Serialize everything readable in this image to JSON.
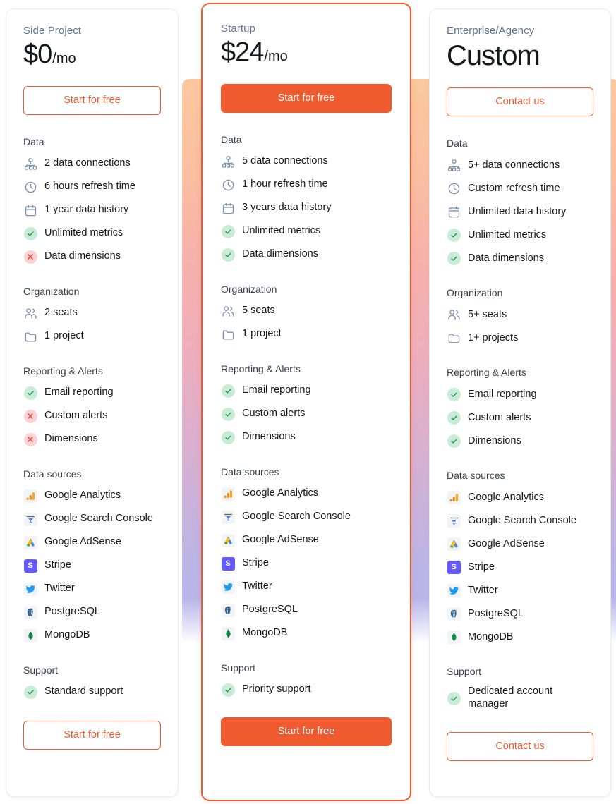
{
  "theme": {
    "accent": "#ef5a2e",
    "plan_name_color": "#64748b",
    "yes_color": "#1f9254",
    "no_color": "#e8403a",
    "gradient_from": "#fbc89d",
    "gradient_to": "#b3b6ee"
  },
  "plans": [
    {
      "id": "side-project",
      "name": "Side Project",
      "price": "$0",
      "period": "/mo",
      "cta_top": "Start for free",
      "cta_bottom": "Start for free",
      "featured": false,
      "sections": [
        {
          "title": "Data",
          "items": [
            {
              "icon": "network-icon",
              "label": "2 data connections"
            },
            {
              "icon": "clock-icon",
              "label": "6 hours refresh time"
            },
            {
              "icon": "calendar-icon",
              "label": "1 year data history"
            },
            {
              "icon": "check-circle-icon",
              "label": "Unlimited metrics"
            },
            {
              "icon": "x-circle-icon",
              "label": "Data dimensions"
            }
          ]
        },
        {
          "title": "Organization",
          "items": [
            {
              "icon": "users-icon",
              "label": "2 seats"
            },
            {
              "icon": "folder-icon",
              "label": "1 project"
            }
          ]
        },
        {
          "title": "Reporting & Alerts",
          "items": [
            {
              "icon": "check-circle-icon",
              "label": "Email reporting"
            },
            {
              "icon": "x-circle-icon",
              "label": "Custom alerts"
            },
            {
              "icon": "x-circle-icon",
              "label": "Dimensions"
            }
          ]
        },
        {
          "title": "Data sources",
          "items": [
            {
              "icon": "google-analytics-icon",
              "label": "Google Analytics"
            },
            {
              "icon": "google-search-console-icon",
              "label": "Google Search Console"
            },
            {
              "icon": "google-adsense-icon",
              "label": "Google AdSense"
            },
            {
              "icon": "stripe-icon",
              "label": "Stripe"
            },
            {
              "icon": "twitter-icon",
              "label": "Twitter"
            },
            {
              "icon": "postgresql-icon",
              "label": "PostgreSQL"
            },
            {
              "icon": "mongodb-icon",
              "label": "MongoDB"
            }
          ]
        },
        {
          "title": "Support",
          "items": [
            {
              "icon": "check-circle-icon",
              "label": "Standard support"
            }
          ]
        }
      ]
    },
    {
      "id": "startup",
      "name": "Startup",
      "price": "$24",
      "period": "/mo",
      "cta_top": "Start for free",
      "cta_bottom": "Start for free",
      "featured": true,
      "sections": [
        {
          "title": "Data",
          "items": [
            {
              "icon": "network-icon",
              "label": "5 data connections"
            },
            {
              "icon": "clock-icon",
              "label": "1 hour refresh time"
            },
            {
              "icon": "calendar-icon",
              "label": "3 years data history"
            },
            {
              "icon": "check-circle-icon",
              "label": "Unlimited metrics"
            },
            {
              "icon": "check-circle-icon",
              "label": "Data dimensions"
            }
          ]
        },
        {
          "title": "Organization",
          "items": [
            {
              "icon": "users-icon",
              "label": "5 seats"
            },
            {
              "icon": "folder-icon",
              "label": "1 project"
            }
          ]
        },
        {
          "title": "Reporting & Alerts",
          "items": [
            {
              "icon": "check-circle-icon",
              "label": "Email reporting"
            },
            {
              "icon": "check-circle-icon",
              "label": "Custom alerts"
            },
            {
              "icon": "check-circle-icon",
              "label": "Dimensions"
            }
          ]
        },
        {
          "title": "Data sources",
          "items": [
            {
              "icon": "google-analytics-icon",
              "label": "Google Analytics"
            },
            {
              "icon": "google-search-console-icon",
              "label": "Google Search Console"
            },
            {
              "icon": "google-adsense-icon",
              "label": "Google AdSense"
            },
            {
              "icon": "stripe-icon",
              "label": "Stripe"
            },
            {
              "icon": "twitter-icon",
              "label": "Twitter"
            },
            {
              "icon": "postgresql-icon",
              "label": "PostgreSQL"
            },
            {
              "icon": "mongodb-icon",
              "label": "MongoDB"
            }
          ]
        },
        {
          "title": "Support",
          "items": [
            {
              "icon": "check-circle-icon",
              "label": "Priority support"
            }
          ]
        }
      ]
    },
    {
      "id": "enterprise-agency",
      "name": "Enterprise/Agency",
      "price": "Custom",
      "period": "",
      "cta_top": "Contact us",
      "cta_bottom": "Contact us",
      "featured": false,
      "sections": [
        {
          "title": "Data",
          "items": [
            {
              "icon": "network-icon",
              "label": "5+ data connections"
            },
            {
              "icon": "clock-icon",
              "label": "Custom refresh time"
            },
            {
              "icon": "calendar-icon",
              "label": "Unlimited data history"
            },
            {
              "icon": "check-circle-icon",
              "label": "Unlimited metrics"
            },
            {
              "icon": "check-circle-icon",
              "label": "Data dimensions"
            }
          ]
        },
        {
          "title": "Organization",
          "items": [
            {
              "icon": "users-icon",
              "label": "5+ seats"
            },
            {
              "icon": "folder-icon",
              "label": "1+ projects"
            }
          ]
        },
        {
          "title": "Reporting & Alerts",
          "items": [
            {
              "icon": "check-circle-icon",
              "label": "Email reporting"
            },
            {
              "icon": "check-circle-icon",
              "label": "Custom alerts"
            },
            {
              "icon": "check-circle-icon",
              "label": "Dimensions"
            }
          ]
        },
        {
          "title": "Data sources",
          "items": [
            {
              "icon": "google-analytics-icon",
              "label": "Google Analytics"
            },
            {
              "icon": "google-search-console-icon",
              "label": "Google Search Console"
            },
            {
              "icon": "google-adsense-icon",
              "label": "Google AdSense"
            },
            {
              "icon": "stripe-icon",
              "label": "Stripe"
            },
            {
              "icon": "twitter-icon",
              "label": "Twitter"
            },
            {
              "icon": "postgresql-icon",
              "label": "PostgreSQL"
            },
            {
              "icon": "mongodb-icon",
              "label": "MongoDB"
            }
          ]
        },
        {
          "title": "Support",
          "items": [
            {
              "icon": "check-circle-icon",
              "label": "Dedicated account manager"
            }
          ]
        }
      ]
    }
  ]
}
